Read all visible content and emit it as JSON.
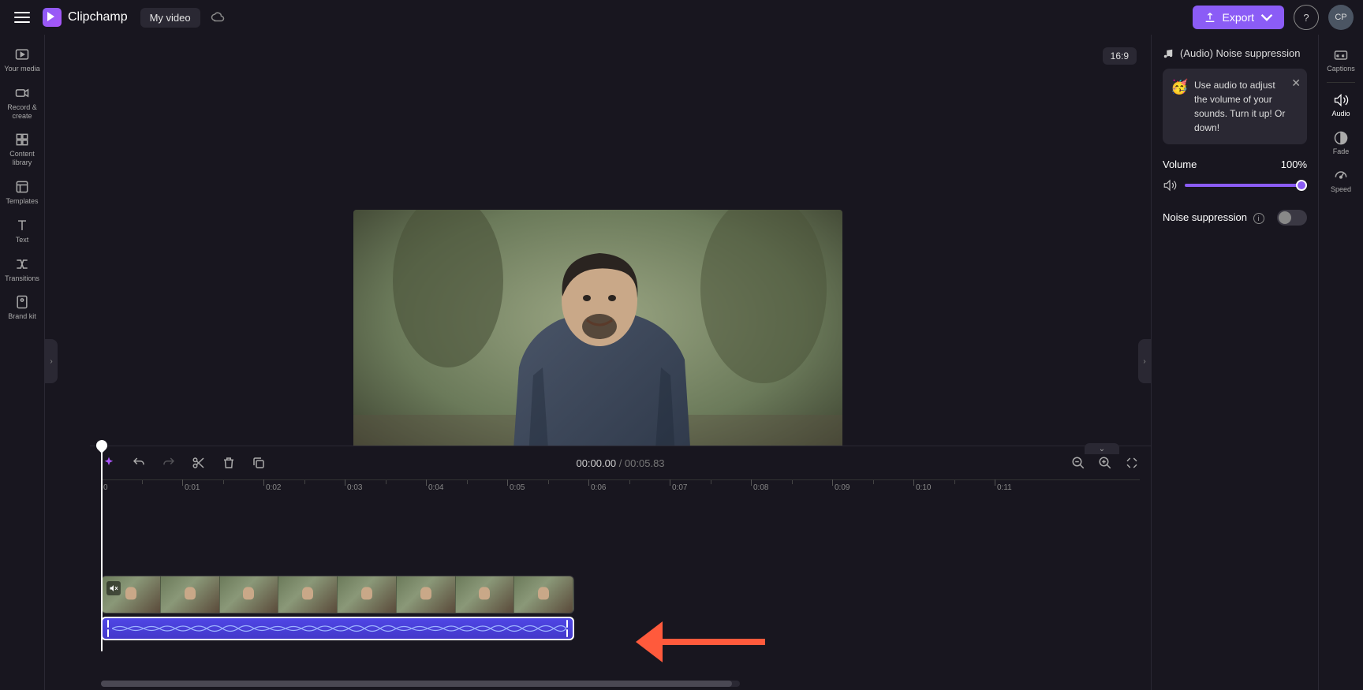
{
  "app": {
    "name": "Clipchamp",
    "project_title": "My video"
  },
  "topbar": {
    "export_label": "Export",
    "avatar_initials": "CP"
  },
  "sidebar": {
    "items": [
      {
        "label": "Your media"
      },
      {
        "label": "Record & create"
      },
      {
        "label": "Content library"
      },
      {
        "label": "Templates"
      },
      {
        "label": "Text"
      },
      {
        "label": "Transitions"
      },
      {
        "label": "Brand kit"
      }
    ]
  },
  "preview": {
    "aspect_label": "16:9"
  },
  "audio_panel": {
    "header": "(Audio) Noise suppression",
    "tip_text": "Use audio to adjust the volume of your sounds. Turn it up! Or down!",
    "volume_label": "Volume",
    "volume_value": "100%",
    "noise_label": "Noise suppression"
  },
  "far_sidebar": {
    "items": [
      {
        "label": "Captions"
      },
      {
        "label": "Audio"
      },
      {
        "label": "Fade"
      },
      {
        "label": "Speed"
      }
    ]
  },
  "timeline": {
    "current_time": "00:00.00",
    "separator": " / ",
    "duration": "00:05.83",
    "ruler_labels": [
      "0",
      "0:01",
      "0:02",
      "0:03",
      "0:04",
      "0:05",
      "0:06",
      "0:07",
      "0:08",
      "0:09",
      "0:10",
      "0:11"
    ]
  }
}
